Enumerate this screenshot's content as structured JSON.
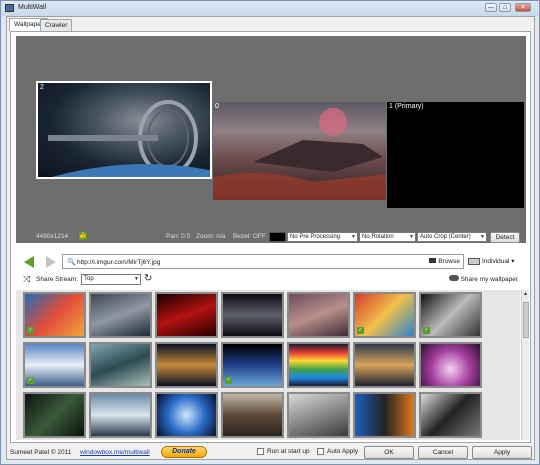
{
  "window": {
    "title": "MultiWall",
    "controls": [
      "—",
      "□",
      "✕"
    ]
  },
  "tabs": [
    {
      "label": "Wallpaper"
    },
    {
      "label": "Crawler"
    }
  ],
  "monitors": [
    {
      "label": "2"
    },
    {
      "label": "0"
    },
    {
      "label": "1 (Primary)"
    }
  ],
  "preview_controls": {
    "resolution": "4480x1214",
    "pan": "Pan: 0.0",
    "zoom": "Zoom: n/a",
    "bezel": "Bezel: OFF",
    "processing": "No Pre Processing",
    "rotation": "No Rotation",
    "crop": "Auto Crop (Center)",
    "detect_label": "Detect"
  },
  "navigation": {
    "url": "http://i.imgur.com/MirTj6Y.jpg",
    "browse_label": "Browse",
    "mode_label": "Individual"
  },
  "stream": {
    "label": "Share Stream:",
    "selected": "Top",
    "share_label": "Share my wallpaper"
  },
  "gallery": {
    "thumbnails": [
      {
        "name": "coral-reef",
        "liked": true
      },
      {
        "name": "space-station",
        "liked": false
      },
      {
        "name": "red-nebula",
        "liked": false
      },
      {
        "name": "spaceship",
        "liked": false
      },
      {
        "name": "clouds-tree",
        "liked": false
      },
      {
        "name": "colorful-painting",
        "liked": true
      },
      {
        "name": "bw-characters",
        "liked": true
      },
      {
        "name": "mountains",
        "liked": true
      },
      {
        "name": "fantasy-valley",
        "liked": false
      },
      {
        "name": "city-night",
        "liked": false
      },
      {
        "name": "earth-horizon",
        "liked": true
      },
      {
        "name": "rainbow-pixel",
        "liked": false
      },
      {
        "name": "city-lights",
        "liked": false
      },
      {
        "name": "purple-glow",
        "liked": false
      },
      {
        "name": "dark-texture",
        "liked": false
      },
      {
        "name": "planet-surface",
        "liked": false
      },
      {
        "name": "blue-galaxy",
        "liked": false
      },
      {
        "name": "landscape-birds",
        "liked": false
      },
      {
        "name": "white-tiger",
        "liked": false
      },
      {
        "name": "portal-characters",
        "liked": false
      },
      {
        "name": "bw-warrior",
        "liked": false
      }
    ]
  },
  "footer": {
    "copyright": "Sumeet Patel © 2011",
    "link": "windowbox.me/multiwall",
    "donate_label": "Donate",
    "run_at_startup": "Run at start up",
    "auto_apply": "Auto Apply",
    "ok_label": "OK",
    "cancel_label": "Cancel",
    "apply_label": "Apply"
  },
  "colors": {
    "accent_green": "#56a02b",
    "preview_bg": "#6e6e6e",
    "link": "#1a3ea8"
  }
}
